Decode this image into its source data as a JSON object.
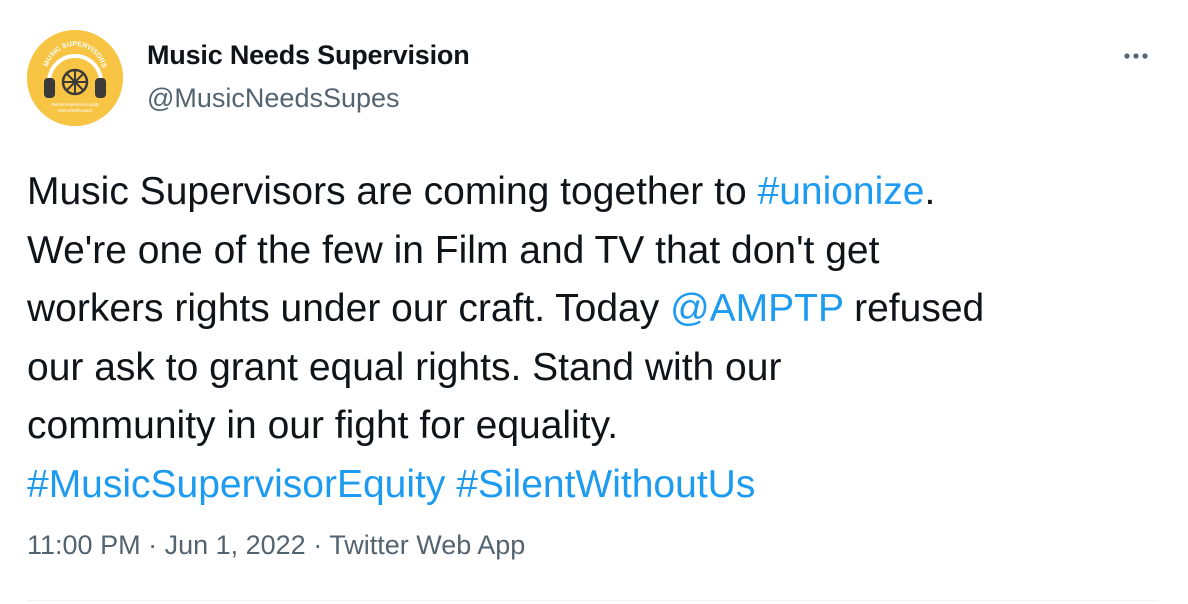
{
  "author": {
    "display_name": "Music Needs Supervision",
    "handle": "@MusicNeedsSupes",
    "avatar": {
      "ring_text": "MUSIC SUPERVISORS",
      "bottom_text_1": "#MusicSupervisorEquity",
      "bottom_text_2": "#SilentWithoutUs",
      "bg_color": "#f7c443"
    }
  },
  "menu": {
    "more_icon": "more-horizontal-icon"
  },
  "tweet": {
    "lines": [
      {
        "t1": "Music Supervisors are coming together to ",
        "l1": "#unionize",
        "t2": "."
      },
      {
        "t1": "We're one of the few in Film and TV that don't get"
      },
      {
        "t1": "workers rights under our craft. Today ",
        "l1": "@AMPTP",
        "t2": " refused"
      },
      {
        "t1": "our ask to grant equal rights. Stand with our"
      },
      {
        "t1": "community in our fight for equality."
      },
      {
        "l1": "#MusicSupervisorEquity",
        "t2": " ",
        "l2": "#SilentWithoutUs"
      }
    ]
  },
  "meta": {
    "time": "11:00 PM",
    "sep1": " · ",
    "date": "Jun 1, 2022",
    "sep2": " · ",
    "source": "Twitter Web App"
  },
  "colors": {
    "link": "#1d9bf0",
    "text": "#0f1419",
    "secondary": "#536471"
  }
}
